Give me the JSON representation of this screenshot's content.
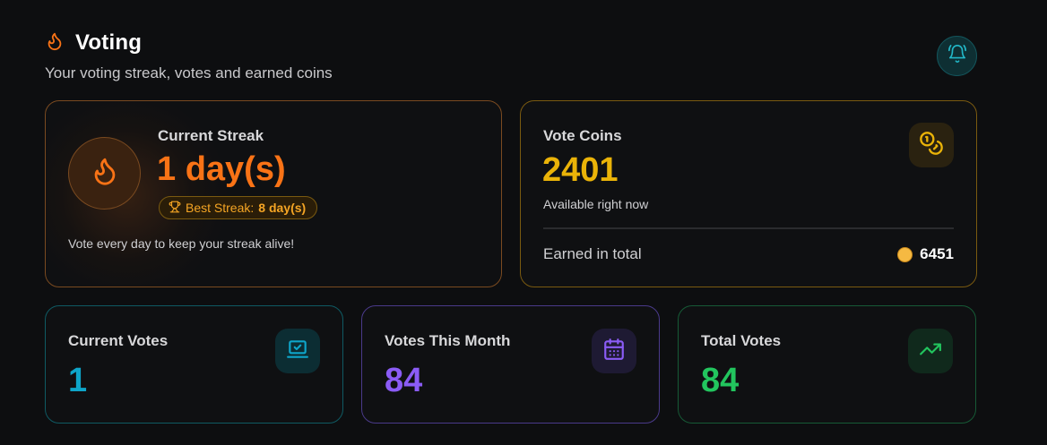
{
  "header": {
    "title": "Voting",
    "subtitle": "Your voting streak, votes and earned coins",
    "title_icon": "flame-icon",
    "notification_icon": "bell-icon"
  },
  "streak": {
    "label": "Current Streak",
    "value": "1 day(s)",
    "best_label": "Best Streak:",
    "best_value": "8 day(s)",
    "hint": "Vote every day to keep your streak alive!",
    "icon": "flame-icon",
    "accent": "#f97316"
  },
  "coins": {
    "label": "Vote Coins",
    "value": "2401",
    "available": "Available right now",
    "earned_label": "Earned in total",
    "earned_value": "6451",
    "icon": "coins-icon",
    "accent": "#eab308"
  },
  "stats": {
    "current": {
      "label": "Current Votes",
      "value": "1",
      "icon": "laptop-check-icon",
      "accent": "#0ea5c9"
    },
    "month": {
      "label": "Votes This Month",
      "value": "84",
      "icon": "calendar-icon",
      "accent": "#8b5cf6"
    },
    "total": {
      "label": "Total Votes",
      "value": "84",
      "icon": "trending-up-icon",
      "accent": "#22c55e"
    }
  }
}
